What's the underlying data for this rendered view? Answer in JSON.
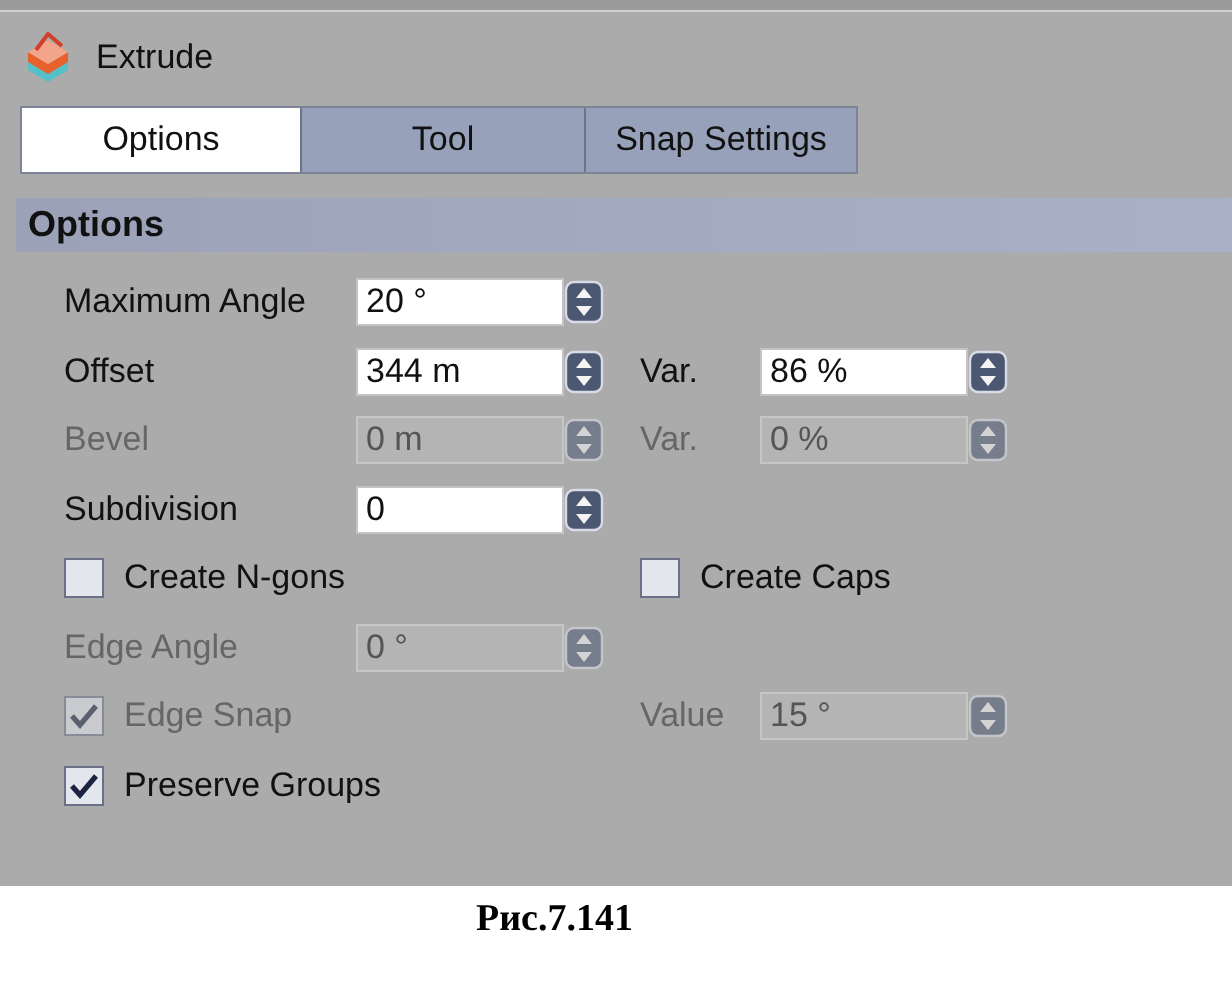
{
  "tool": {
    "title": "Extrude"
  },
  "tabs": [
    {
      "label": "Options",
      "selected": true
    },
    {
      "label": "Tool",
      "selected": false
    },
    {
      "label": "Snap Settings",
      "selected": false
    }
  ],
  "section": {
    "title": "Options"
  },
  "rows": [
    {
      "left": {
        "kind": "field",
        "label": "Maximum Angle",
        "value": "20 °",
        "disabled": false
      }
    },
    {
      "left": {
        "kind": "field",
        "label": "Offset",
        "value": "344 m",
        "disabled": false
      },
      "right": {
        "kind": "field",
        "label": "Var.",
        "value": "86 %",
        "disabled": false
      }
    },
    {
      "left": {
        "kind": "field",
        "label": "Bevel",
        "value": "0 m",
        "disabled": true
      },
      "right": {
        "kind": "field",
        "label": "Var.",
        "value": "0 %",
        "disabled": true
      }
    },
    {
      "left": {
        "kind": "field",
        "label": "Subdivision",
        "value": "0",
        "disabled": false
      }
    },
    {
      "left": {
        "kind": "checkbox",
        "label": "Create N-gons",
        "checked": false,
        "disabled": false
      },
      "right": {
        "kind": "checkbox",
        "label": "Create Caps",
        "checked": false,
        "disabled": false
      }
    },
    {
      "left": {
        "kind": "field",
        "label": "Edge Angle",
        "value": "0 °",
        "disabled": true
      }
    },
    {
      "left": {
        "kind": "checkbox",
        "label": "Edge Snap",
        "checked": true,
        "disabled": true
      },
      "right": {
        "kind": "field",
        "label": "Value",
        "value": "15 °",
        "disabled": true
      }
    },
    {
      "left": {
        "kind": "checkbox",
        "label": "Preserve Groups",
        "checked": true,
        "disabled": false
      }
    }
  ],
  "caption": "Рис.7.141"
}
